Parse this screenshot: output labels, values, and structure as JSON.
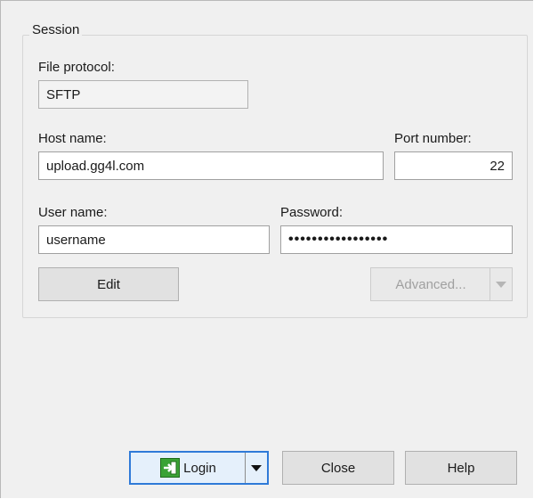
{
  "session": {
    "group_title": "Session",
    "file_protocol": {
      "label": "File protocol:",
      "value": "SFTP"
    },
    "host_name": {
      "label": "Host name:",
      "value": "upload.gg4l.com"
    },
    "port_number": {
      "label": "Port number:",
      "value": "22"
    },
    "user_name": {
      "label": "User name:",
      "value": "username"
    },
    "password": {
      "label": "Password:",
      "value": "•••••••••••••••••"
    },
    "edit_label": "Edit",
    "advanced_label": "Advanced..."
  },
  "footer": {
    "login_label": "Login",
    "close_label": "Close",
    "help_label": "Help"
  },
  "icons": {
    "login": "login-arrow-icon",
    "dropdown": "chevron-down-icon"
  },
  "colors": {
    "accent": "#2f7ad8",
    "login_icon": "#3aa235"
  }
}
